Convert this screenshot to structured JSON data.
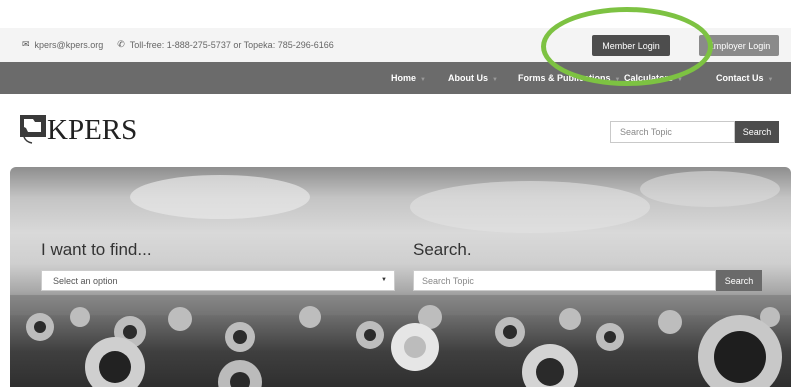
{
  "topbar": {
    "email": "kpers@kpers.org",
    "phone": "Toll-free: 1-888-275-5737 or Topeka: 785-296-6166",
    "email_icon": "envelope-icon",
    "phone_icon": "phone-icon",
    "member_login": "Member Login",
    "employer_login": "Employer Login"
  },
  "nav": {
    "items": [
      {
        "label": "Home"
      },
      {
        "label": "About Us"
      },
      {
        "label": "Forms & Publications"
      },
      {
        "label": "Calculators"
      },
      {
        "label": "Contact Us"
      }
    ]
  },
  "header": {
    "logo_text": "KPERS",
    "search_placeholder": "Search Topic",
    "search_button": "Search"
  },
  "hero": {
    "find_heading": "I want to find...",
    "select_value": "Select an option",
    "search_heading": "Search.",
    "search_placeholder": "Search Topic",
    "search_button": "Search"
  },
  "colors": {
    "annotation": "#7dc242",
    "nav_bg": "#6b6b6b",
    "button_dark": "#4d4d4d"
  }
}
